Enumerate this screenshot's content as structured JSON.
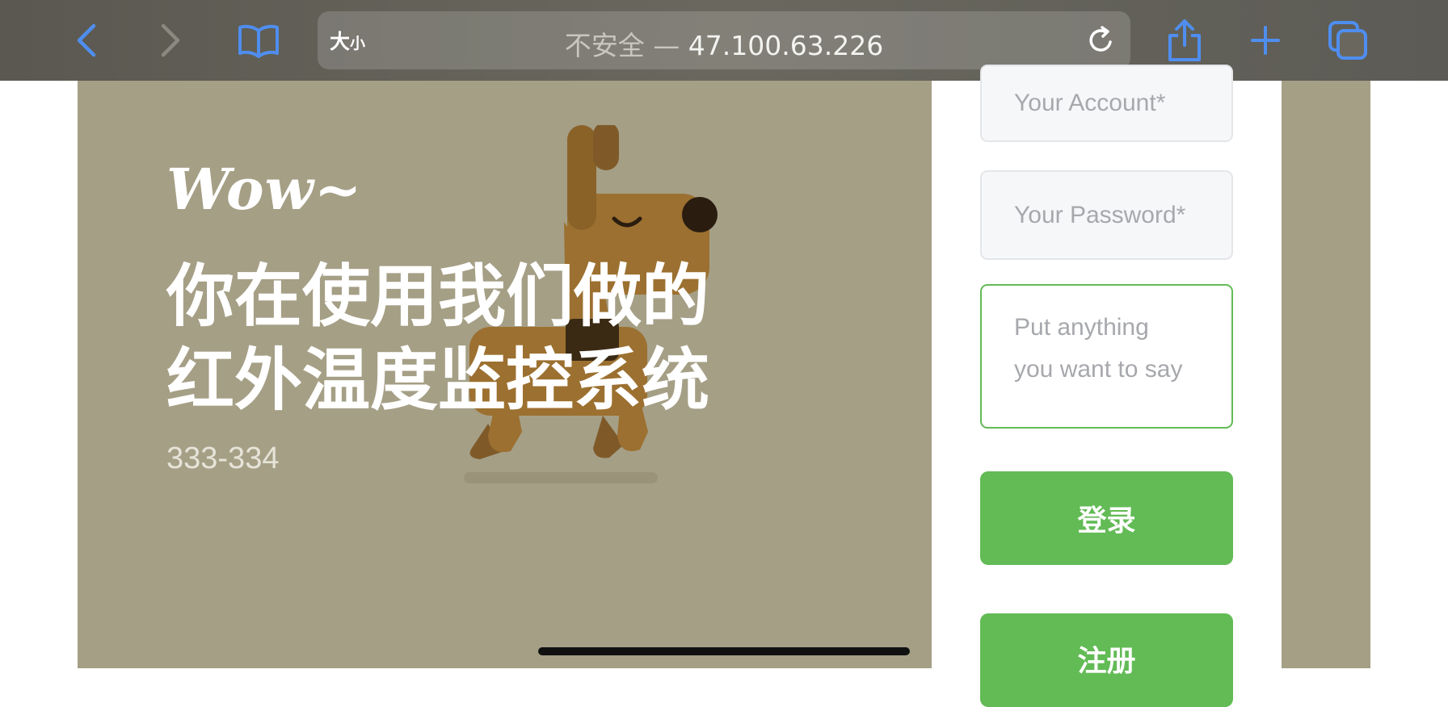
{
  "browser": {
    "text_size_big": "大",
    "text_size_small": "小",
    "url_insecure": "不安全 —",
    "url_host": "47.100.63.226",
    "icons": [
      "back-icon",
      "forward-icon",
      "bookmarks-icon",
      "reload-icon",
      "share-icon",
      "new-tab-icon",
      "tabs-icon"
    ],
    "accent_color": "#4f8ef0"
  },
  "hero": {
    "greeting": "Wow~",
    "headline_line1": "你在使用我们做的",
    "headline_line2": "红外温度监控系统",
    "subtitle": "333-334",
    "background_color": "#a59f86"
  },
  "form": {
    "account_placeholder": "Your Account*",
    "password_placeholder": "Your Password*",
    "message_line1": "Put anything",
    "message_line2": "you want to say",
    "login_label": "登录",
    "register_label": "注册",
    "button_color": "#62bb55"
  }
}
